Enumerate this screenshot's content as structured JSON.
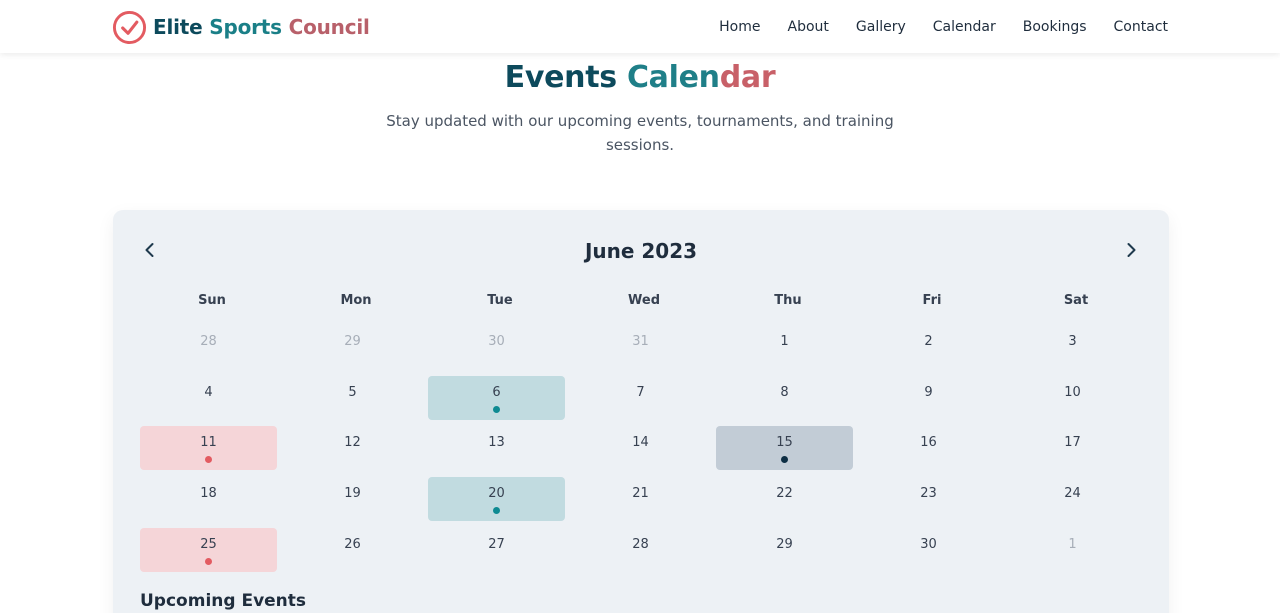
{
  "brand": {
    "name_part1": "Elite",
    "name_part2": "Sports",
    "name_part3": "Council",
    "logo_icon": "check-circle-icon",
    "colors": {
      "dark_teal": "#0d4a5c",
      "teal": "#1a7f87",
      "coral": "#e35b61"
    }
  },
  "nav": {
    "items": [
      {
        "label": "Home"
      },
      {
        "label": "About"
      },
      {
        "label": "Gallery"
      },
      {
        "label": "Calendar"
      },
      {
        "label": "Bookings"
      },
      {
        "label": "Contact"
      }
    ]
  },
  "hero": {
    "title_part1": "Events ",
    "title_part2": "Calen",
    "title_part3": "dar",
    "subtitle": "Stay updated with our upcoming events, tournaments, and training sessions."
  },
  "calendar": {
    "month_label": "June 2023",
    "prev_icon": "chevron-left-icon",
    "next_icon": "chevron-right-icon",
    "weekdays": [
      "Sun",
      "Mon",
      "Tue",
      "Wed",
      "Thu",
      "Fri",
      "Sat"
    ],
    "event_colors": {
      "teal": {
        "bg": "#c1dbe0",
        "dot": "#0e8a92"
      },
      "red": {
        "bg": "#f5d5d8",
        "dot": "#e35b61"
      },
      "navy": {
        "bg": "#c2ccd6",
        "dot": "#0d2e44"
      }
    },
    "weeks": [
      [
        {
          "day": "28",
          "other": true
        },
        {
          "day": "29",
          "other": true
        },
        {
          "day": "30",
          "other": true
        },
        {
          "day": "31",
          "other": true
        },
        {
          "day": "1"
        },
        {
          "day": "2"
        },
        {
          "day": "3"
        }
      ],
      [
        {
          "day": "4"
        },
        {
          "day": "5"
        },
        {
          "day": "6",
          "event": "teal"
        },
        {
          "day": "7"
        },
        {
          "day": "8"
        },
        {
          "day": "9"
        },
        {
          "day": "10"
        }
      ],
      [
        {
          "day": "11",
          "event": "red"
        },
        {
          "day": "12"
        },
        {
          "day": "13"
        },
        {
          "day": "14"
        },
        {
          "day": "15",
          "event": "navy"
        },
        {
          "day": "16"
        },
        {
          "day": "17"
        }
      ],
      [
        {
          "day": "18"
        },
        {
          "day": "19"
        },
        {
          "day": "20",
          "event": "teal"
        },
        {
          "day": "21"
        },
        {
          "day": "22"
        },
        {
          "day": "23"
        },
        {
          "day": "24"
        }
      ],
      [
        {
          "day": "25",
          "event": "red"
        },
        {
          "day": "26"
        },
        {
          "day": "27"
        },
        {
          "day": "28"
        },
        {
          "day": "29"
        },
        {
          "day": "30"
        },
        {
          "day": "1",
          "other": true
        }
      ]
    ]
  },
  "upcoming": {
    "title": "Upcoming Events"
  }
}
